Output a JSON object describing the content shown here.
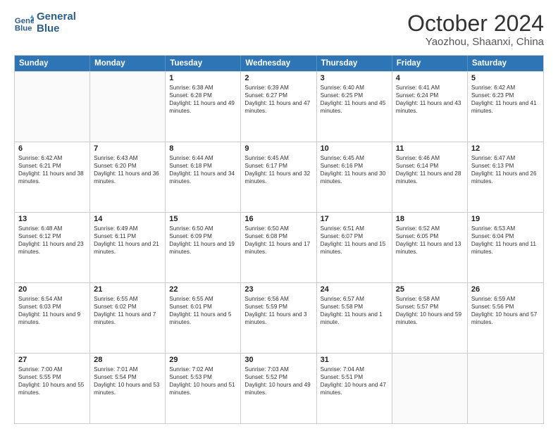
{
  "logo": {
    "line1": "General",
    "line2": "Blue"
  },
  "title": "October 2024",
  "location": "Yaozhou, Shaanxi, China",
  "weekdays": [
    "Sunday",
    "Monday",
    "Tuesday",
    "Wednesday",
    "Thursday",
    "Friday",
    "Saturday"
  ],
  "rows": [
    [
      {
        "day": "",
        "sunrise": "",
        "sunset": "",
        "daylight": ""
      },
      {
        "day": "",
        "sunrise": "",
        "sunset": "",
        "daylight": ""
      },
      {
        "day": "1",
        "sunrise": "Sunrise: 6:38 AM",
        "sunset": "Sunset: 6:28 PM",
        "daylight": "Daylight: 11 hours and 49 minutes."
      },
      {
        "day": "2",
        "sunrise": "Sunrise: 6:39 AM",
        "sunset": "Sunset: 6:27 PM",
        "daylight": "Daylight: 11 hours and 47 minutes."
      },
      {
        "day": "3",
        "sunrise": "Sunrise: 6:40 AM",
        "sunset": "Sunset: 6:25 PM",
        "daylight": "Daylight: 11 hours and 45 minutes."
      },
      {
        "day": "4",
        "sunrise": "Sunrise: 6:41 AM",
        "sunset": "Sunset: 6:24 PM",
        "daylight": "Daylight: 11 hours and 43 minutes."
      },
      {
        "day": "5",
        "sunrise": "Sunrise: 6:42 AM",
        "sunset": "Sunset: 6:23 PM",
        "daylight": "Daylight: 11 hours and 41 minutes."
      }
    ],
    [
      {
        "day": "6",
        "sunrise": "Sunrise: 6:42 AM",
        "sunset": "Sunset: 6:21 PM",
        "daylight": "Daylight: 11 hours and 38 minutes."
      },
      {
        "day": "7",
        "sunrise": "Sunrise: 6:43 AM",
        "sunset": "Sunset: 6:20 PM",
        "daylight": "Daylight: 11 hours and 36 minutes."
      },
      {
        "day": "8",
        "sunrise": "Sunrise: 6:44 AM",
        "sunset": "Sunset: 6:18 PM",
        "daylight": "Daylight: 11 hours and 34 minutes."
      },
      {
        "day": "9",
        "sunrise": "Sunrise: 6:45 AM",
        "sunset": "Sunset: 6:17 PM",
        "daylight": "Daylight: 11 hours and 32 minutes."
      },
      {
        "day": "10",
        "sunrise": "Sunrise: 6:45 AM",
        "sunset": "Sunset: 6:16 PM",
        "daylight": "Daylight: 11 hours and 30 minutes."
      },
      {
        "day": "11",
        "sunrise": "Sunrise: 6:46 AM",
        "sunset": "Sunset: 6:14 PM",
        "daylight": "Daylight: 11 hours and 28 minutes."
      },
      {
        "day": "12",
        "sunrise": "Sunrise: 6:47 AM",
        "sunset": "Sunset: 6:13 PM",
        "daylight": "Daylight: 11 hours and 26 minutes."
      }
    ],
    [
      {
        "day": "13",
        "sunrise": "Sunrise: 6:48 AM",
        "sunset": "Sunset: 6:12 PM",
        "daylight": "Daylight: 11 hours and 23 minutes."
      },
      {
        "day": "14",
        "sunrise": "Sunrise: 6:49 AM",
        "sunset": "Sunset: 6:11 PM",
        "daylight": "Daylight: 11 hours and 21 minutes."
      },
      {
        "day": "15",
        "sunrise": "Sunrise: 6:50 AM",
        "sunset": "Sunset: 6:09 PM",
        "daylight": "Daylight: 11 hours and 19 minutes."
      },
      {
        "day": "16",
        "sunrise": "Sunrise: 6:50 AM",
        "sunset": "Sunset: 6:08 PM",
        "daylight": "Daylight: 11 hours and 17 minutes."
      },
      {
        "day": "17",
        "sunrise": "Sunrise: 6:51 AM",
        "sunset": "Sunset: 6:07 PM",
        "daylight": "Daylight: 11 hours and 15 minutes."
      },
      {
        "day": "18",
        "sunrise": "Sunrise: 6:52 AM",
        "sunset": "Sunset: 6:05 PM",
        "daylight": "Daylight: 11 hours and 13 minutes."
      },
      {
        "day": "19",
        "sunrise": "Sunrise: 6:53 AM",
        "sunset": "Sunset: 6:04 PM",
        "daylight": "Daylight: 11 hours and 11 minutes."
      }
    ],
    [
      {
        "day": "20",
        "sunrise": "Sunrise: 6:54 AM",
        "sunset": "Sunset: 6:03 PM",
        "daylight": "Daylight: 11 hours and 9 minutes."
      },
      {
        "day": "21",
        "sunrise": "Sunrise: 6:55 AM",
        "sunset": "Sunset: 6:02 PM",
        "daylight": "Daylight: 11 hours and 7 minutes."
      },
      {
        "day": "22",
        "sunrise": "Sunrise: 6:55 AM",
        "sunset": "Sunset: 6:01 PM",
        "daylight": "Daylight: 11 hours and 5 minutes."
      },
      {
        "day": "23",
        "sunrise": "Sunrise: 6:56 AM",
        "sunset": "Sunset: 5:59 PM",
        "daylight": "Daylight: 11 hours and 3 minutes."
      },
      {
        "day": "24",
        "sunrise": "Sunrise: 6:57 AM",
        "sunset": "Sunset: 5:58 PM",
        "daylight": "Daylight: 11 hours and 1 minute."
      },
      {
        "day": "25",
        "sunrise": "Sunrise: 6:58 AM",
        "sunset": "Sunset: 5:57 PM",
        "daylight": "Daylight: 10 hours and 59 minutes."
      },
      {
        "day": "26",
        "sunrise": "Sunrise: 6:59 AM",
        "sunset": "Sunset: 5:56 PM",
        "daylight": "Daylight: 10 hours and 57 minutes."
      }
    ],
    [
      {
        "day": "27",
        "sunrise": "Sunrise: 7:00 AM",
        "sunset": "Sunset: 5:55 PM",
        "daylight": "Daylight: 10 hours and 55 minutes."
      },
      {
        "day": "28",
        "sunrise": "Sunrise: 7:01 AM",
        "sunset": "Sunset: 5:54 PM",
        "daylight": "Daylight: 10 hours and 53 minutes."
      },
      {
        "day": "29",
        "sunrise": "Sunrise: 7:02 AM",
        "sunset": "Sunset: 5:53 PM",
        "daylight": "Daylight: 10 hours and 51 minutes."
      },
      {
        "day": "30",
        "sunrise": "Sunrise: 7:03 AM",
        "sunset": "Sunset: 5:52 PM",
        "daylight": "Daylight: 10 hours and 49 minutes."
      },
      {
        "day": "31",
        "sunrise": "Sunrise: 7:04 AM",
        "sunset": "Sunset: 5:51 PM",
        "daylight": "Daylight: 10 hours and 47 minutes."
      },
      {
        "day": "",
        "sunrise": "",
        "sunset": "",
        "daylight": ""
      },
      {
        "day": "",
        "sunrise": "",
        "sunset": "",
        "daylight": ""
      }
    ]
  ]
}
